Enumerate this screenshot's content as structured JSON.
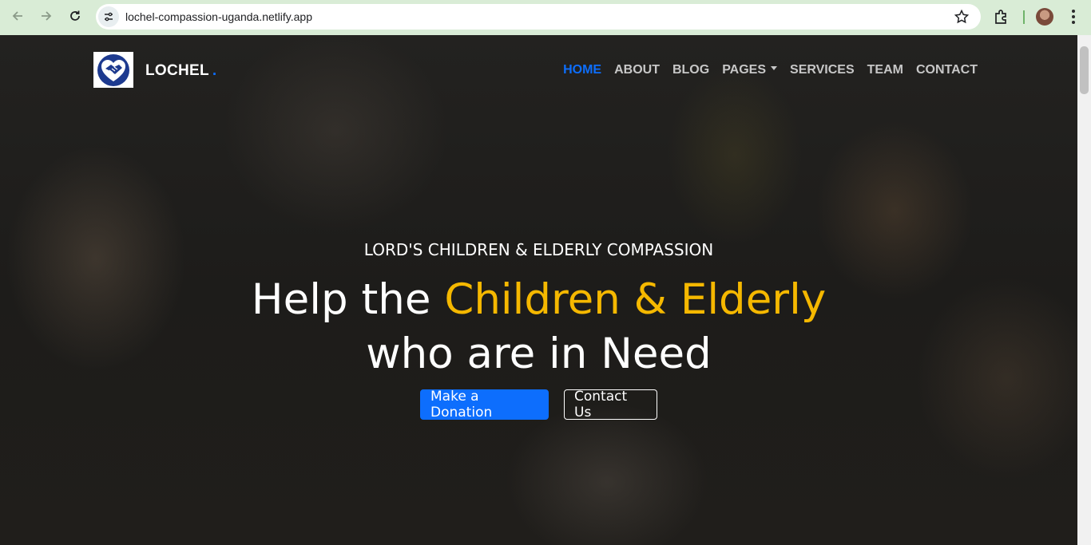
{
  "browser": {
    "url": "lochel-compassion-uganda.netlify.app",
    "icons": [
      "back-arrow-icon",
      "forward-arrow-icon",
      "reload-icon",
      "site-settings-icon",
      "star-icon",
      "extensions-icon",
      "profile-avatar",
      "menu-dots-icon"
    ]
  },
  "site": {
    "brand": "LOCHEL",
    "brand_dot": ".",
    "nav": {
      "home": "HOME",
      "about": "ABOUT",
      "blog": "BLOG",
      "pages": "PAGES",
      "services": "SERVICES",
      "team": "TEAM",
      "contact": "CONTACT"
    },
    "active_nav": "HOME"
  },
  "hero": {
    "subtitle": "LORD'S CHILDREN & ELDERLY COMPASSION",
    "title_part1": "Help the ",
    "title_highlight": "Children & Elderly",
    "title_line2": "who are in Need",
    "donate_button": "Make a Donation",
    "contact_button": "Contact Us"
  },
  "colors": {
    "accent": "#0d6efd",
    "highlight": "#f5b800",
    "chrome_bg": "#d9ecd6"
  }
}
